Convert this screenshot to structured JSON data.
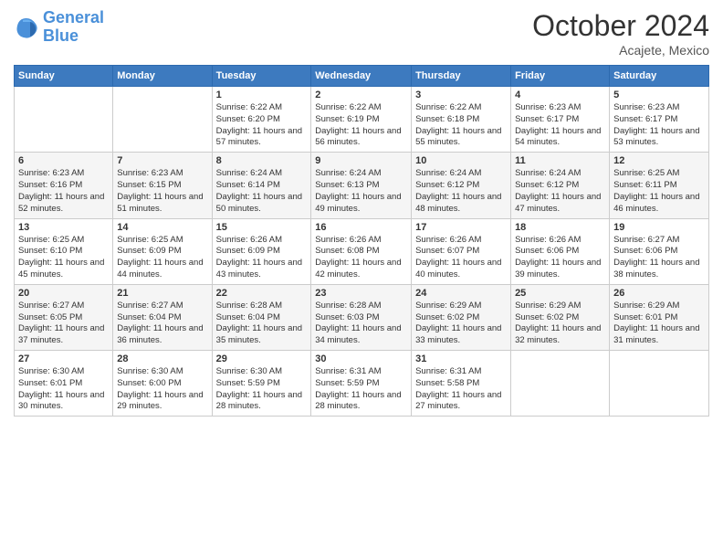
{
  "header": {
    "logo_line1": "General",
    "logo_line2": "Blue",
    "month": "October 2024",
    "location": "Acajete, Mexico"
  },
  "weekdays": [
    "Sunday",
    "Monday",
    "Tuesday",
    "Wednesday",
    "Thursday",
    "Friday",
    "Saturday"
  ],
  "weeks": [
    [
      {
        "day": "",
        "info": ""
      },
      {
        "day": "",
        "info": ""
      },
      {
        "day": "1",
        "info": "Sunrise: 6:22 AM\nSunset: 6:20 PM\nDaylight: 11 hours and 57 minutes."
      },
      {
        "day": "2",
        "info": "Sunrise: 6:22 AM\nSunset: 6:19 PM\nDaylight: 11 hours and 56 minutes."
      },
      {
        "day": "3",
        "info": "Sunrise: 6:22 AM\nSunset: 6:18 PM\nDaylight: 11 hours and 55 minutes."
      },
      {
        "day": "4",
        "info": "Sunrise: 6:23 AM\nSunset: 6:17 PM\nDaylight: 11 hours and 54 minutes."
      },
      {
        "day": "5",
        "info": "Sunrise: 6:23 AM\nSunset: 6:17 PM\nDaylight: 11 hours and 53 minutes."
      }
    ],
    [
      {
        "day": "6",
        "info": "Sunrise: 6:23 AM\nSunset: 6:16 PM\nDaylight: 11 hours and 52 minutes."
      },
      {
        "day": "7",
        "info": "Sunrise: 6:23 AM\nSunset: 6:15 PM\nDaylight: 11 hours and 51 minutes."
      },
      {
        "day": "8",
        "info": "Sunrise: 6:24 AM\nSunset: 6:14 PM\nDaylight: 11 hours and 50 minutes."
      },
      {
        "day": "9",
        "info": "Sunrise: 6:24 AM\nSunset: 6:13 PM\nDaylight: 11 hours and 49 minutes."
      },
      {
        "day": "10",
        "info": "Sunrise: 6:24 AM\nSunset: 6:12 PM\nDaylight: 11 hours and 48 minutes."
      },
      {
        "day": "11",
        "info": "Sunrise: 6:24 AM\nSunset: 6:12 PM\nDaylight: 11 hours and 47 minutes."
      },
      {
        "day": "12",
        "info": "Sunrise: 6:25 AM\nSunset: 6:11 PM\nDaylight: 11 hours and 46 minutes."
      }
    ],
    [
      {
        "day": "13",
        "info": "Sunrise: 6:25 AM\nSunset: 6:10 PM\nDaylight: 11 hours and 45 minutes."
      },
      {
        "day": "14",
        "info": "Sunrise: 6:25 AM\nSunset: 6:09 PM\nDaylight: 11 hours and 44 minutes."
      },
      {
        "day": "15",
        "info": "Sunrise: 6:26 AM\nSunset: 6:09 PM\nDaylight: 11 hours and 43 minutes."
      },
      {
        "day": "16",
        "info": "Sunrise: 6:26 AM\nSunset: 6:08 PM\nDaylight: 11 hours and 42 minutes."
      },
      {
        "day": "17",
        "info": "Sunrise: 6:26 AM\nSunset: 6:07 PM\nDaylight: 11 hours and 40 minutes."
      },
      {
        "day": "18",
        "info": "Sunrise: 6:26 AM\nSunset: 6:06 PM\nDaylight: 11 hours and 39 minutes."
      },
      {
        "day": "19",
        "info": "Sunrise: 6:27 AM\nSunset: 6:06 PM\nDaylight: 11 hours and 38 minutes."
      }
    ],
    [
      {
        "day": "20",
        "info": "Sunrise: 6:27 AM\nSunset: 6:05 PM\nDaylight: 11 hours and 37 minutes."
      },
      {
        "day": "21",
        "info": "Sunrise: 6:27 AM\nSunset: 6:04 PM\nDaylight: 11 hours and 36 minutes."
      },
      {
        "day": "22",
        "info": "Sunrise: 6:28 AM\nSunset: 6:04 PM\nDaylight: 11 hours and 35 minutes."
      },
      {
        "day": "23",
        "info": "Sunrise: 6:28 AM\nSunset: 6:03 PM\nDaylight: 11 hours and 34 minutes."
      },
      {
        "day": "24",
        "info": "Sunrise: 6:29 AM\nSunset: 6:02 PM\nDaylight: 11 hours and 33 minutes."
      },
      {
        "day": "25",
        "info": "Sunrise: 6:29 AM\nSunset: 6:02 PM\nDaylight: 11 hours and 32 minutes."
      },
      {
        "day": "26",
        "info": "Sunrise: 6:29 AM\nSunset: 6:01 PM\nDaylight: 11 hours and 31 minutes."
      }
    ],
    [
      {
        "day": "27",
        "info": "Sunrise: 6:30 AM\nSunset: 6:01 PM\nDaylight: 11 hours and 30 minutes."
      },
      {
        "day": "28",
        "info": "Sunrise: 6:30 AM\nSunset: 6:00 PM\nDaylight: 11 hours and 29 minutes."
      },
      {
        "day": "29",
        "info": "Sunrise: 6:30 AM\nSunset: 5:59 PM\nDaylight: 11 hours and 28 minutes."
      },
      {
        "day": "30",
        "info": "Sunrise: 6:31 AM\nSunset: 5:59 PM\nDaylight: 11 hours and 28 minutes."
      },
      {
        "day": "31",
        "info": "Sunrise: 6:31 AM\nSunset: 5:58 PM\nDaylight: 11 hours and 27 minutes."
      },
      {
        "day": "",
        "info": ""
      },
      {
        "day": "",
        "info": ""
      }
    ]
  ]
}
